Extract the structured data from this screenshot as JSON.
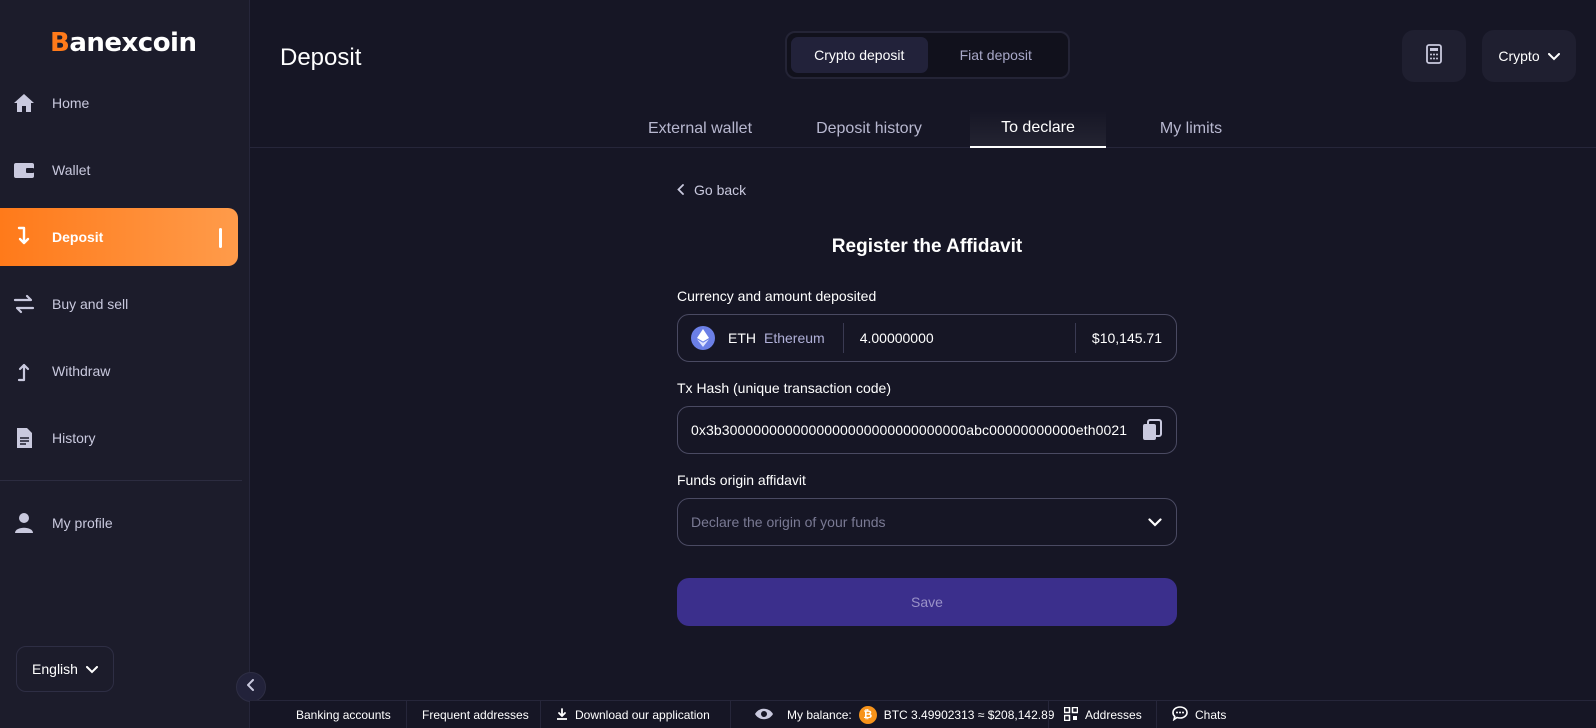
{
  "brand": {
    "logo_prefix": "B",
    "logo_rest": "anexcoin",
    "accent_color": "#ff7a1a"
  },
  "sidebar": {
    "items": [
      {
        "label": "Home",
        "icon": "home-icon"
      },
      {
        "label": "Wallet",
        "icon": "wallet-icon"
      },
      {
        "label": "Deposit",
        "icon": "deposit-arrow-icon",
        "active": true
      },
      {
        "label": "Buy and sell",
        "icon": "swap-icon"
      },
      {
        "label": "Withdraw",
        "icon": "withdraw-arrow-icon"
      },
      {
        "label": "History",
        "icon": "document-icon"
      },
      {
        "label": "My profile",
        "icon": "user-icon"
      }
    ],
    "language": "English"
  },
  "header": {
    "title": "Deposit",
    "segments": [
      {
        "label": "Crypto deposit",
        "active": true
      },
      {
        "label": "Fiat deposit",
        "active": false
      }
    ],
    "mode_selector": "Crypto"
  },
  "tabs": [
    {
      "label": "External wallet"
    },
    {
      "label": "Deposit history"
    },
    {
      "label": "To declare",
      "active": true
    },
    {
      "label": "My limits"
    }
  ],
  "form": {
    "go_back": "Go back",
    "title": "Register the Affidavit",
    "currency_label": "Currency and amount deposited",
    "currency_code": "ETH",
    "currency_name": "Ethereum",
    "amount": "4.00000000",
    "usd_value": "$10,145.71",
    "tx_label": "Tx Hash (unique transaction code)",
    "tx_hash": "0x3b3000000000000000000000000000000abc00000000000eth0021",
    "origin_label": "Funds origin affidavit",
    "origin_placeholder": "Declare the origin of your funds",
    "save_label": "Save"
  },
  "footer": {
    "banking": "Banking accounts",
    "frequent": "Frequent addresses",
    "download": "Download our application",
    "balance_label": "My balance:",
    "balance_value": "BTC 3.49902313 ≈ $208,142.89",
    "addresses": "Addresses",
    "chats": "Chats"
  }
}
